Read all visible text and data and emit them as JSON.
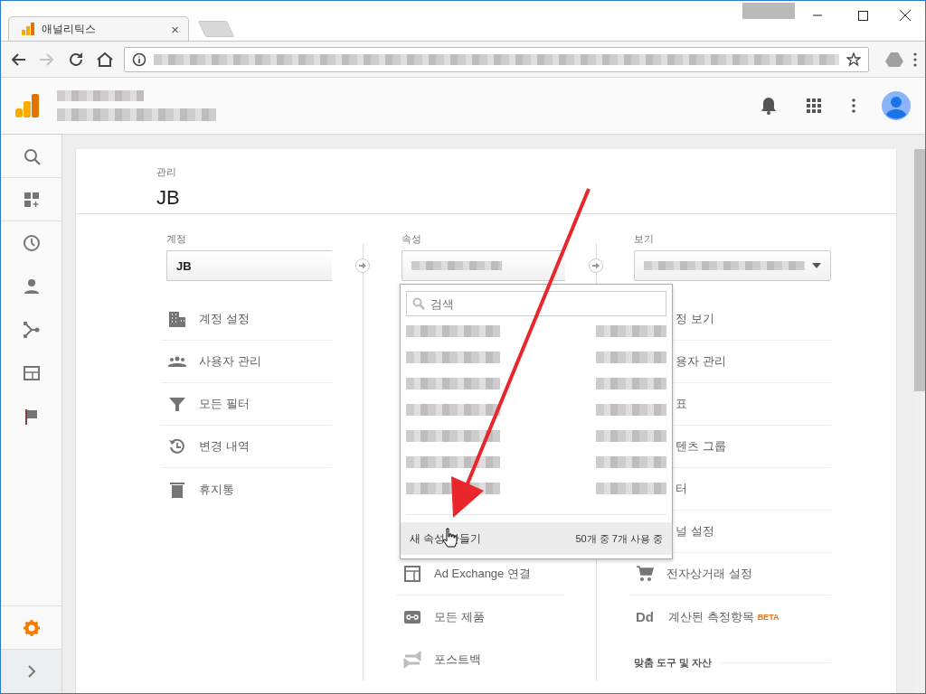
{
  "browser": {
    "tab": {
      "title": "애널리틱스",
      "close": "×",
      "selected": true
    },
    "nav": [
      {
        "kind": "back",
        "disabled": false
      },
      {
        "kind": "forward",
        "disabled": true
      },
      {
        "kind": "reload",
        "disabled": false
      },
      {
        "kind": "home",
        "disabled": false
      }
    ]
  },
  "sidebar": {
    "items": [
      {
        "kind": "search",
        "selected": false
      },
      {
        "kind": "dashboard",
        "selected": false
      },
      {
        "kind": "clock",
        "selected": false
      },
      {
        "kind": "person",
        "selected": false
      },
      {
        "kind": "fork",
        "selected": false
      },
      {
        "kind": "layout",
        "selected": false
      },
      {
        "kind": "flag",
        "selected": false
      }
    ],
    "bottom": [
      {
        "kind": "gear",
        "selected": true
      },
      {
        "kind": "chevron",
        "selected": false
      }
    ]
  },
  "page": {
    "section": "관리",
    "title": "JB"
  },
  "account": {
    "label": "계정",
    "value": "JB",
    "items": [
      {
        "kind": "building",
        "label": "계정 설정"
      },
      {
        "kind": "people",
        "label": "사용자 관리"
      },
      {
        "kind": "funnel",
        "label": "모든 필터"
      },
      {
        "kind": "history",
        "label": "변경 내역"
      },
      {
        "kind": "trash",
        "label": "휴지통"
      }
    ]
  },
  "property": {
    "label": "속성",
    "items": [
      {
        "kind": "panel",
        "label": "Ad Exchange 연결"
      },
      {
        "kind": "link",
        "label": "모든 제품"
      },
      {
        "kind": "swap",
        "label": "포스트백"
      }
    ]
  },
  "view": {
    "label": "보기",
    "items": [
      {
        "kind": "covered",
        "label": "정 보기"
      },
      {
        "kind": "covered",
        "label": "용자 관리"
      },
      {
        "kind": "covered",
        "label": "표"
      },
      {
        "kind": "covered",
        "label": "텐츠 그룹"
      },
      {
        "kind": "covered",
        "label": "터"
      },
      {
        "kind": "covered",
        "label": "널 설정"
      },
      {
        "kind": "cart",
        "label": "전자상거래 설정"
      },
      {
        "kind": "dd",
        "label": "계산된 측정항목",
        "icon_text": "Dd",
        "badge": "BETA"
      }
    ],
    "heading": "맞춤 도구 및 자산"
  },
  "dropdown": {
    "placeholder": "검색",
    "create": "새 속성 만들기",
    "count": "50개 중 7개 사용 중"
  }
}
